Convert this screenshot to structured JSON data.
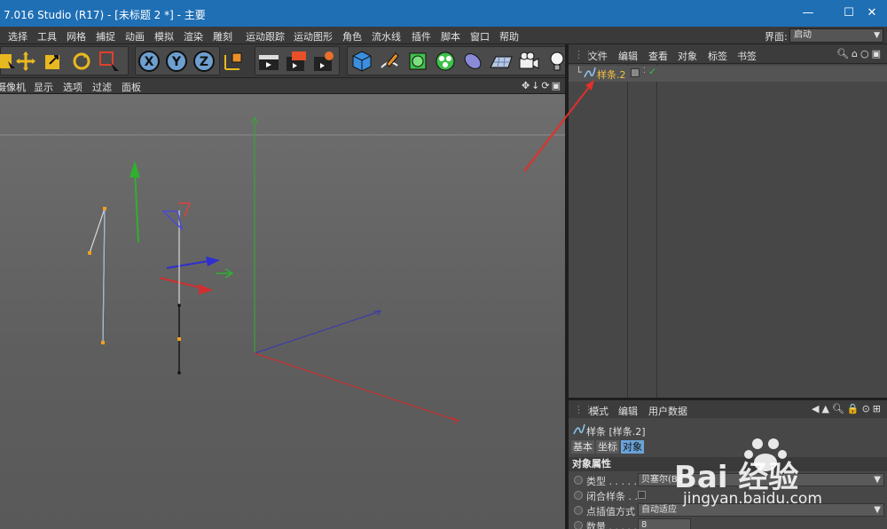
{
  "window": {
    "title": "7.016 Studio (R17) - [未标题 2 *] - 主要",
    "controls": [
      "—",
      "☐",
      "✕"
    ]
  },
  "menubar": {
    "items": [
      "选择",
      "工具",
      "网格",
      "捕捉",
      "动画",
      "模拟",
      "渲染",
      "雕刻",
      "运动跟踪",
      "运动图形",
      "角色",
      "流水线",
      "插件",
      "脚本",
      "窗口",
      "帮助"
    ],
    "layout_label": "界面:",
    "layout_value": "启动"
  },
  "toolbar": {
    "tools": [
      "live-selection-icon",
      "move-icon",
      "scale-icon",
      "rotate-icon",
      "recent-tool-icon",
      "x-axis-lock-icon",
      "y-axis-lock-icon",
      "z-axis-lock-icon",
      "coordinate-system-icon",
      "render-view-icon",
      "render-picture-viewer-icon",
      "render-settings-icon",
      "cube-icon",
      "pen-icon",
      "subdivision-icon",
      "cloner-icon",
      "deformer-icon",
      "floor-icon",
      "camera-icon",
      "light-icon"
    ],
    "axis_labels": [
      "X",
      "Y",
      "Z"
    ]
  },
  "viewport": {
    "menu": [
      "摄像机",
      "显示",
      "选项",
      "过滤",
      "面板"
    ],
    "nav_icons": "✥↓⟳▣"
  },
  "object_manager": {
    "menu": [
      "文件",
      "编辑",
      "查看",
      "对象",
      "标签",
      "书签"
    ],
    "objects": [
      {
        "name": "样条.2",
        "visible_check": "✓"
      }
    ]
  },
  "attributes": {
    "menu": [
      "模式",
      "编辑",
      "用户数据"
    ],
    "object_title": "样条 [样条.2]",
    "tabs": [
      {
        "label": "基本",
        "active": false
      },
      {
        "label": "坐标",
        "active": false
      },
      {
        "label": "对象",
        "active": true
      }
    ],
    "section": "对象属性",
    "rows": [
      {
        "label": "类型 . . . . . . . .",
        "value": "贝塞尔(Bé"
      },
      {
        "label": "闭合样条 . .",
        "value": ""
      },
      {
        "label": "点插值方式",
        "value": "自动适应"
      },
      {
        "label": "数量 . . . . . . . .",
        "value": "8"
      }
    ]
  },
  "watermark": {
    "brand": "Bai 经验",
    "url": "jingyan.baidu.com"
  },
  "colors": {
    "titlebar": "#1f6fb5",
    "accent_tab": "#6aa3d8",
    "object_name": "#f5c242",
    "annotation_arrow": "#e0302a"
  }
}
